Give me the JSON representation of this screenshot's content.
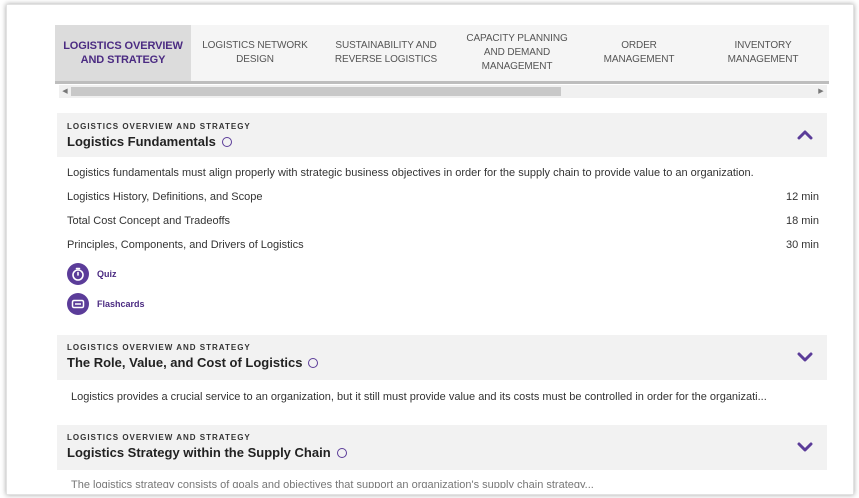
{
  "tabs": [
    {
      "label": "LOGISTICS OVERVIEW AND STRATEGY",
      "active": true
    },
    {
      "label": "LOGISTICS NETWORK DESIGN",
      "active": false
    },
    {
      "label": "SUSTAINABILITY AND REVERSE LOGISTICS",
      "active": false
    },
    {
      "label": "CAPACITY PLANNING AND DEMAND MANAGEMENT",
      "active": false
    },
    {
      "label": "ORDER MANAGEMENT",
      "active": false
    },
    {
      "label": "INVENTORY MANAGEMENT",
      "active": false
    }
  ],
  "modules": [
    {
      "eyebrow": "LOGISTICS OVERVIEW AND STRATEGY",
      "title": "Logistics Fundamentals",
      "expanded": true,
      "description": "Logistics fundamentals must align properly with strategic business objectives in order for the supply chain to provide value to an organization.",
      "lessons": [
        {
          "name": "Logistics History, Definitions, and Scope",
          "duration": "12 min"
        },
        {
          "name": "Total Cost Concept and Tradeoffs",
          "duration": "18 min"
        },
        {
          "name": "Principles, Components, and Drivers of Logistics",
          "duration": "30 min"
        }
      ],
      "activities": [
        {
          "label": "Quiz",
          "icon": "stopwatch-icon"
        },
        {
          "label": "Flashcards",
          "icon": "flashcards-icon"
        }
      ]
    },
    {
      "eyebrow": "LOGISTICS OVERVIEW AND STRATEGY",
      "title": "The Role, Value, and Cost of Logistics",
      "expanded": false,
      "description": "Logistics provides a crucial service to an organization, but it still must provide value and its costs must be controlled in order for the organizati..."
    },
    {
      "eyebrow": "LOGISTICS OVERVIEW AND STRATEGY",
      "title": "Logistics Strategy within the Supply Chain",
      "expanded": false,
      "description": "The logistics strategy consists of goals and objectives that support an organization's supply chain strategy..."
    }
  ],
  "colors": {
    "accent": "#5b3c99",
    "accent_dark": "#4b2b82",
    "header_bg": "#f2f2f2",
    "tab_active_bg": "#dcdcdc"
  }
}
